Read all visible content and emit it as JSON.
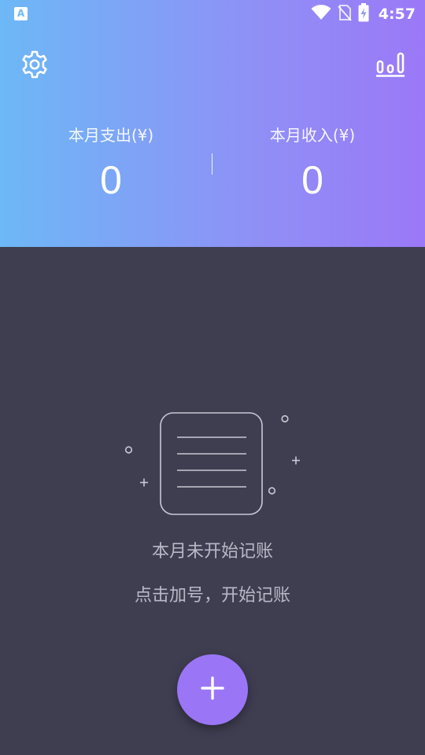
{
  "status_bar": {
    "left_icon": "a-notification-icon",
    "left_icon_glyph": "A",
    "time": "4:57",
    "icons": [
      "wifi-icon",
      "no-sim-icon",
      "battery-charging-icon"
    ]
  },
  "toolbar": {
    "settings_icon": "gear-icon",
    "stats_icon": "bar-chart-icon"
  },
  "summary": {
    "expense_label": "本月支出(¥)",
    "expense_value": "0",
    "income_label": "本月收入(¥)",
    "income_value": "0"
  },
  "empty_state": {
    "illustration_icon": "empty-notebook-icon",
    "title": "本月未开始记账",
    "hint": "点击加号，开始记账"
  },
  "fab": {
    "icon": "plus-icon"
  },
  "colors": {
    "gradient_start": "#6db8f6",
    "gradient_end": "#9b78f7",
    "background": "#3f3e51",
    "fab": "#9a76f6",
    "muted_text": "#b9b8c6"
  }
}
